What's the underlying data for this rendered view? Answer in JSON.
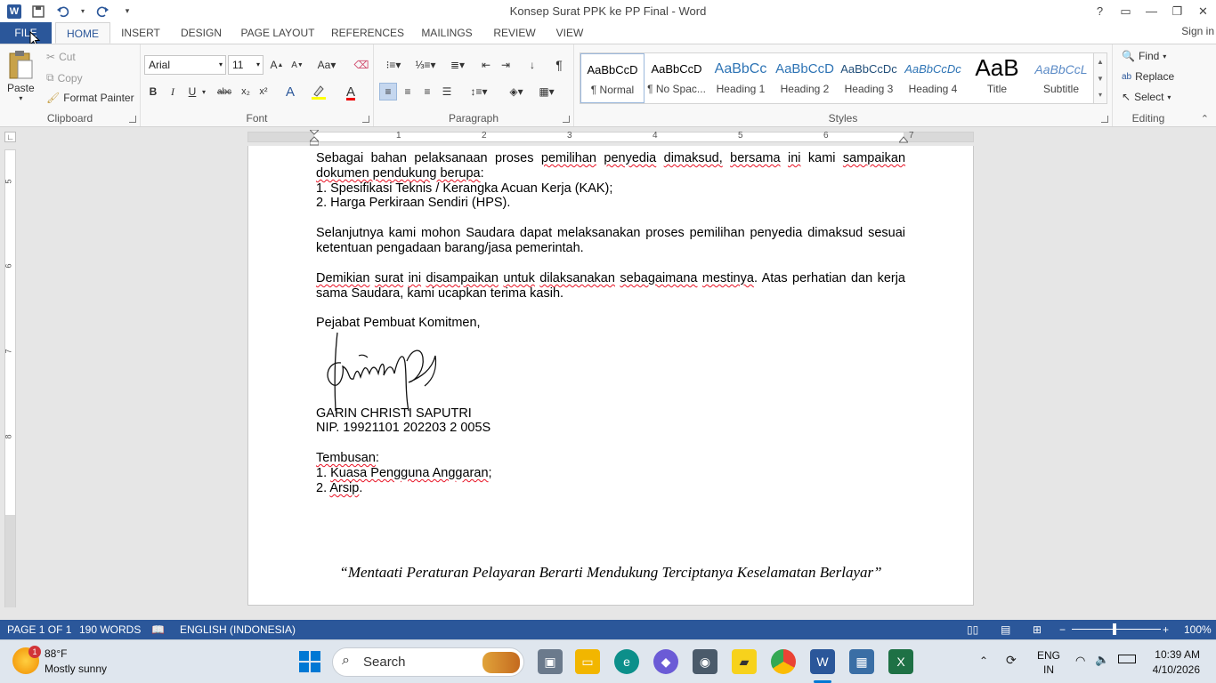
{
  "window": {
    "title": "Konsep Surat PPK ke PP Final - Word"
  },
  "tabs": [
    "FILE",
    "HOME",
    "INSERT",
    "DESIGN",
    "PAGE LAYOUT",
    "REFERENCES",
    "MAILINGS",
    "REVIEW",
    "VIEW"
  ],
  "signin": "Sign in",
  "clipboard": {
    "paste": "Paste",
    "cut": "Cut",
    "copy": "Copy",
    "format_painter": "Format Painter",
    "label": "Clipboard"
  },
  "font": {
    "name": "Arial",
    "size": "11",
    "label": "Font",
    "bold": "B",
    "italic": "I",
    "underline": "U",
    "strike": "abc"
  },
  "paragraph": {
    "label": "Paragraph"
  },
  "styles": {
    "label": "Styles",
    "items": [
      {
        "preview": "AaBbCcD",
        "name": "¶ Normal"
      },
      {
        "preview": "AaBbCcD",
        "name": "¶ No Spac..."
      },
      {
        "preview": "AaBbCc",
        "name": "Heading 1"
      },
      {
        "preview": "AaBbCcD",
        "name": "Heading 2"
      },
      {
        "preview": "AaBbCcDc",
        "name": "Heading 3"
      },
      {
        "preview": "AaBbCcDc",
        "name": "Heading 4"
      },
      {
        "preview": "AaB",
        "name": "Title"
      },
      {
        "preview": "AaBbCcL",
        "name": "Subtitle"
      }
    ]
  },
  "editing": {
    "find": "Find",
    "replace": "Replace",
    "select": "Select",
    "label": "Editing"
  },
  "ruler": {
    "h_numbers": [
      "1",
      "2",
      "3",
      "4",
      "5",
      "6",
      "7"
    ],
    "v_numbers": [
      "5",
      "6",
      "7",
      "8"
    ]
  },
  "document": {
    "p1": {
      "w1": "Sebagai bahan pelaksanaan proses ",
      "w2": "pemilihan",
      "w3": " ",
      "w4": "penyedia",
      "w5": " ",
      "w6": "dimaksud,",
      "w7": " ",
      "w8": "bersama",
      "w9": " ",
      "w10": "ini",
      "w11": " kami ",
      "w12": "sampaikan",
      "w13": " ",
      "w14": "dokumen pendukung berupa",
      "w15": ":"
    },
    "list1": [
      "1.  Spesifikasi Teknis / Kerangka Acuan Kerja (KAK);",
      "2.  Harga Perkiraan Sendiri (HPS)."
    ],
    "p2": "Selanjutnya kami mohon Saudara dapat melaksanakan proses pemilihan penyedia dimaksud sesuai ketentuan pengadaan barang/jasa pemerintah.",
    "p3": {
      "a": "Demikian",
      "b": " ",
      "c": "surat",
      "d": " ",
      "e": "ini",
      "f": " ",
      "g": "disampaikan",
      "h": " ",
      "i": "untuk",
      "j": " ",
      "k": "dilaksanakan",
      "l": " ",
      "m": "sebagaimana",
      "n": " ",
      "o": "mestinya",
      "p": ". Atas perhatian dan kerja sama Saudara, kami ucapkan terima kasih."
    },
    "closing": "Pejabat Pembuat Komitmen,",
    "signer_name": "GARIN CHRISTI SAPUTRI",
    "signer_nip": "NIP.  19921101 202203 2 005S",
    "tembusan": "Tembusan",
    "tembusan_colon": ":",
    "cc": [
      {
        "num": "1. ",
        "text": "Kuasa Pengguna Anggaran",
        "end": ";"
      },
      {
        "num": "2. ",
        "text": "Arsip",
        "end": "."
      }
    ],
    "footer_quote": "“Mentaati Peraturan Pelayaran Berarti Mendukung Terciptanya Keselamatan Berlayar”"
  },
  "status": {
    "page": "PAGE 1 OF 1",
    "words": "190 WORDS",
    "language": "ENGLISH (INDONESIA)",
    "zoom": "100%"
  },
  "taskbar": {
    "weather_temp": "88°F",
    "weather_desc": "Mostly sunny",
    "weather_badge": "1",
    "search_placeholder": "Search",
    "lang1": "ENG",
    "lang2": "IN",
    "time": "10:39 AM",
    "date": "4/10/2026"
  },
  "colors": {
    "accent": "#2b579a",
    "squiggle": "#e81123"
  }
}
